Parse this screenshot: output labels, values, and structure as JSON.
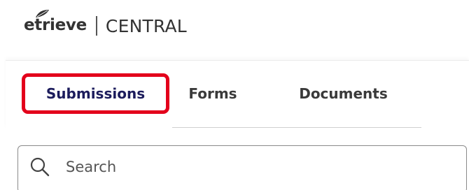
{
  "header": {
    "logo_word": "etrieve",
    "product_name": "CENTRAL"
  },
  "tabs": [
    {
      "label": "Submissions",
      "active": true
    },
    {
      "label": "Forms",
      "active": false
    },
    {
      "label": "Documents",
      "active": false
    }
  ],
  "search": {
    "placeholder": "Search",
    "value": ""
  },
  "colors": {
    "active_tab_text": "#1c1c5c",
    "highlight_border": "#e3001b",
    "text": "#333333"
  },
  "icons": {
    "logo_mark": "leaf-icon",
    "search": "search-icon"
  }
}
